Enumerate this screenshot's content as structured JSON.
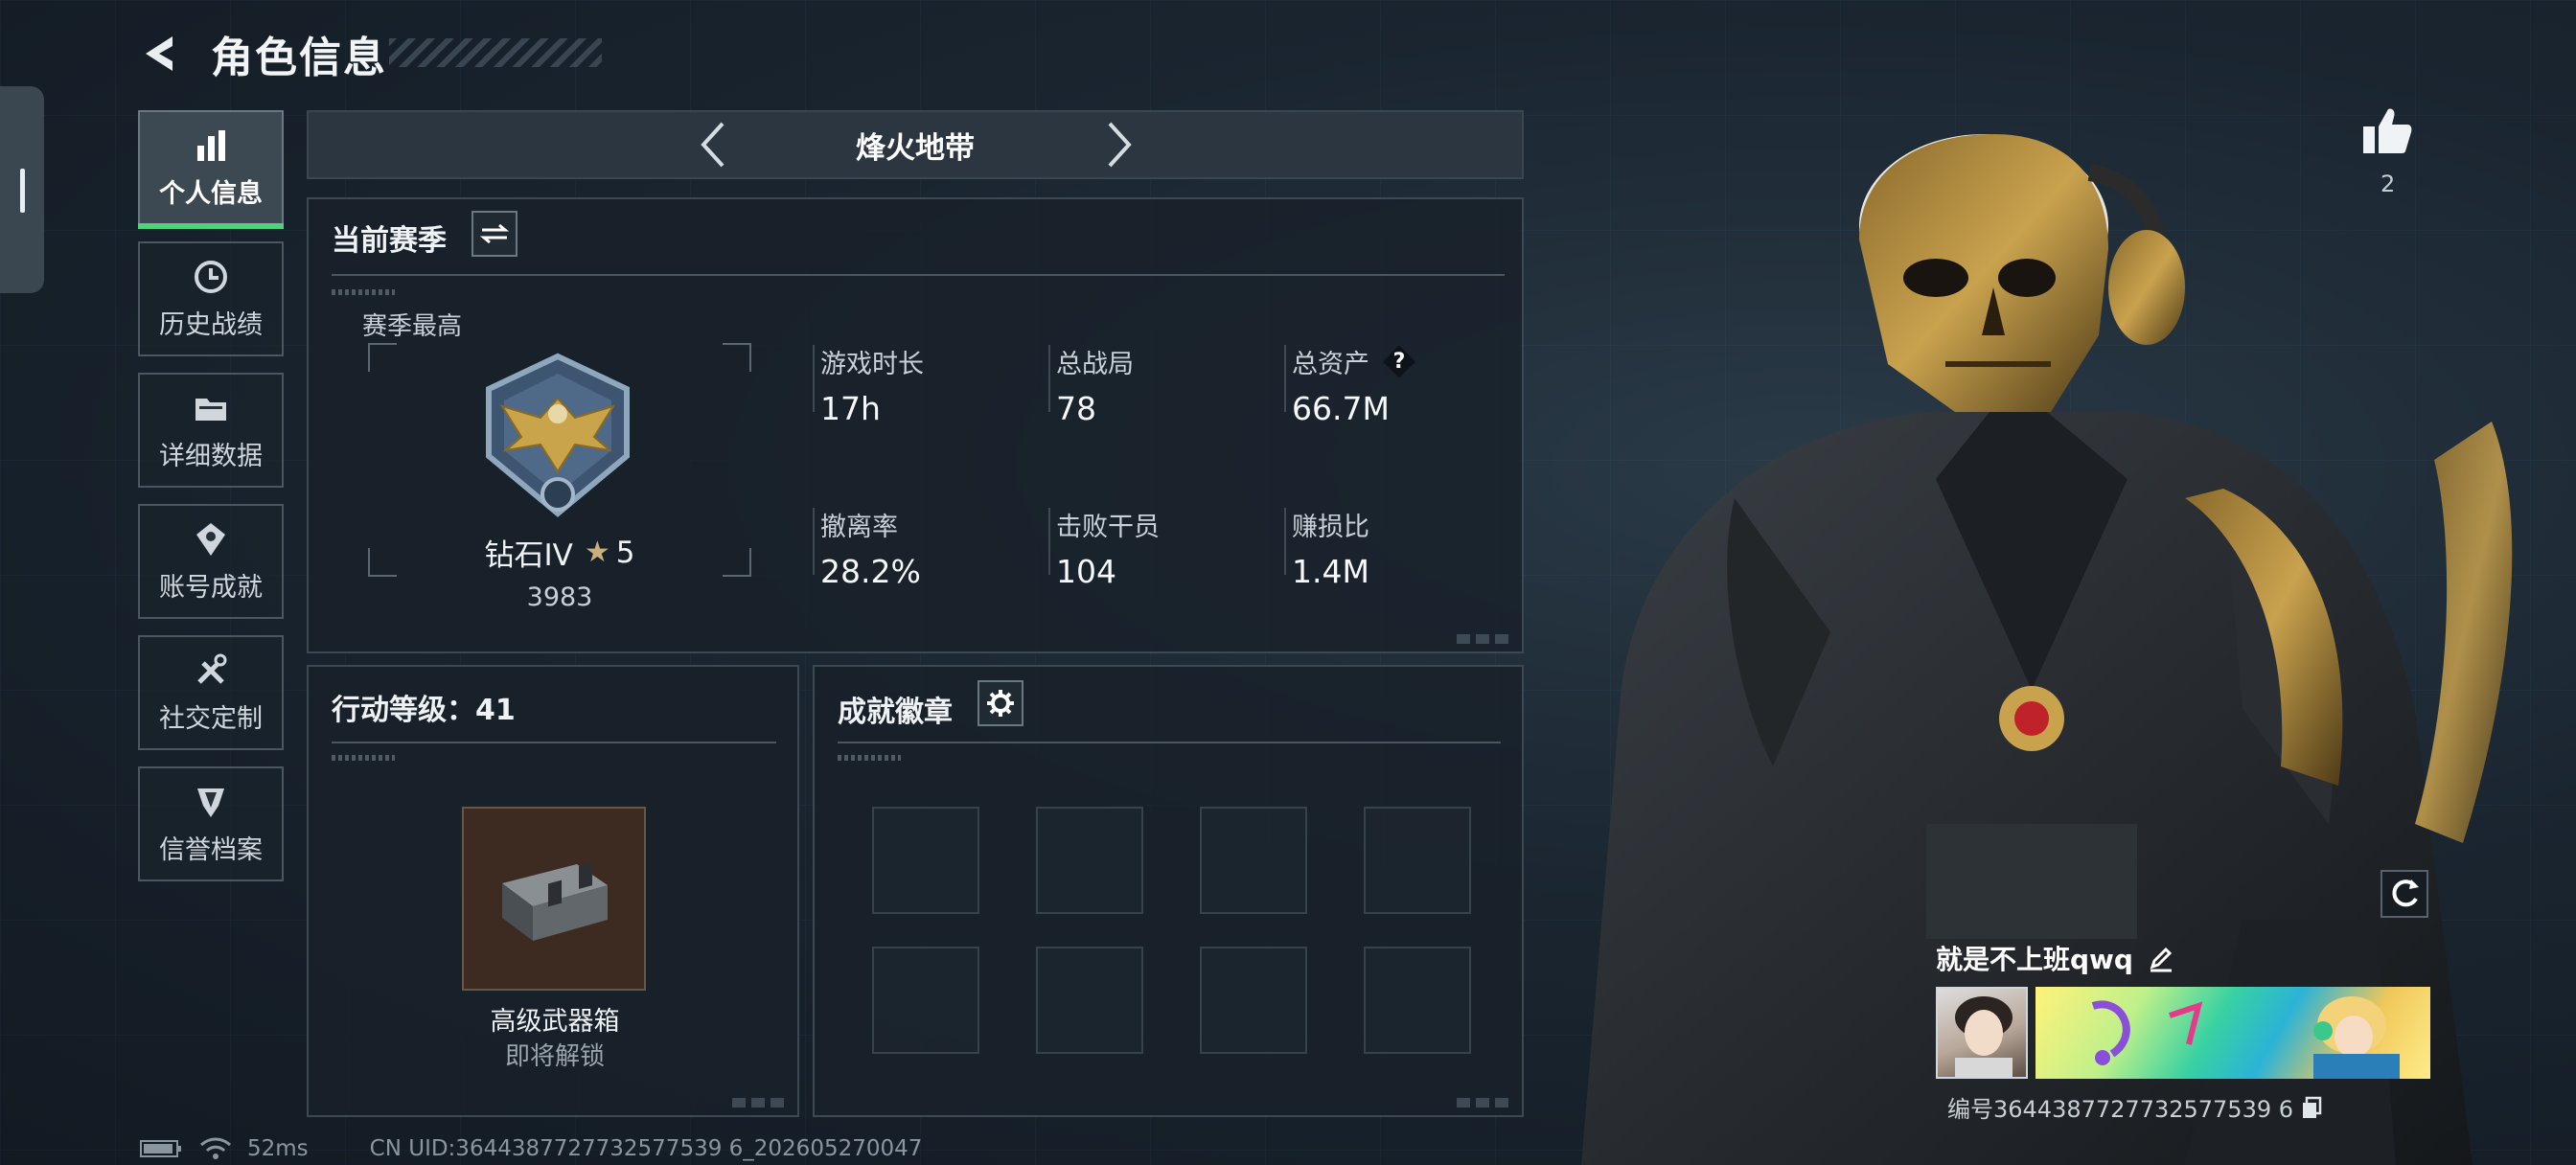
{
  "header": {
    "title": "角色信息"
  },
  "nav": {
    "items": [
      {
        "label": "个人信息",
        "icon": "bar-chart-icon",
        "active": true
      },
      {
        "label": "历史战绩",
        "icon": "history-icon",
        "active": false
      },
      {
        "label": "详细数据",
        "icon": "folder-icon",
        "active": false
      },
      {
        "label": "账号成就",
        "icon": "achievement-icon",
        "active": false
      },
      {
        "label": "社交定制",
        "icon": "tools-icon",
        "active": false
      },
      {
        "label": "信誉档案",
        "icon": "shield-icon",
        "active": false
      }
    ]
  },
  "mode": {
    "name": "烽火地带"
  },
  "season": {
    "title": "当前赛季",
    "best_label": "赛季最高",
    "rank_name": "钻石IV",
    "rank_stars": "5",
    "rank_score": "3983",
    "stats": [
      {
        "label": "游戏时长",
        "value": "17h"
      },
      {
        "label": "总战局",
        "value": "78"
      },
      {
        "label": "总资产",
        "value": "66.7M",
        "help": "?"
      },
      {
        "label": "撤离率",
        "value": "28.2%"
      },
      {
        "label": "击败干员",
        "value": "104"
      },
      {
        "label": "赚损比",
        "value": "1.4M"
      }
    ]
  },
  "level": {
    "title": "行动等级：41",
    "reward_name": "高级武器箱",
    "reward_status": "即将解锁"
  },
  "badges": {
    "title": "成就徽章"
  },
  "likes": {
    "count": "2"
  },
  "player": {
    "name": "就是不上班qwq",
    "id_text": "编号3644387727732577539 6"
  },
  "status": {
    "ping": "52ms",
    "uid": "CN UID:3644387727732577539 6_202605270047"
  },
  "colors": {
    "accent_green": "#4fd37a",
    "bg": "#1a2530"
  }
}
